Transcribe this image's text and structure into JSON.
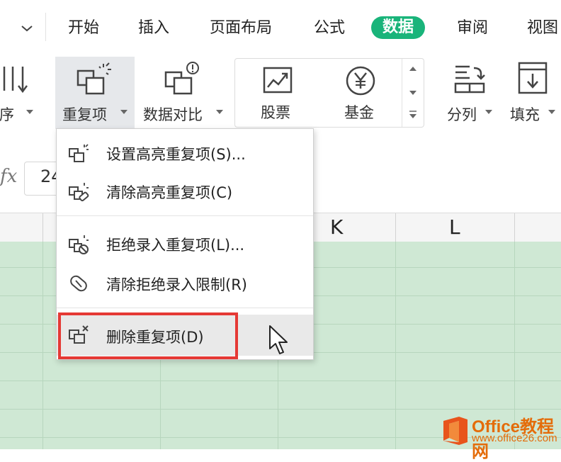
{
  "tabs": [
    {
      "label": "开始"
    },
    {
      "label": "插入"
    },
    {
      "label": "页面布局"
    },
    {
      "label": "公式"
    },
    {
      "label": "数据",
      "active": true
    },
    {
      "label": "审阅"
    },
    {
      "label": "视图"
    }
  ],
  "ribbon": {
    "sort_label": "排序",
    "duplicates_label": "重复项",
    "compare_label": "数据对比",
    "stock_label": "股票",
    "fund_label": "基金",
    "split_label": "分列",
    "fill_label": "填充"
  },
  "formula_bar": {
    "fx": "fx",
    "name_box_value": "24"
  },
  "columns": [
    "K",
    "L"
  ],
  "menu": {
    "items": [
      {
        "label": "设置高亮重复项(S)...",
        "icon": "highlight-duplicates-icon"
      },
      {
        "label": "清除高亮重复项(C)",
        "icon": "clear-highlight-icon"
      },
      {
        "label": "拒绝录入重复项(L)...",
        "icon": "reject-duplicates-icon"
      },
      {
        "label": "清除拒绝录入限制(R)",
        "icon": "clear-restriction-icon"
      },
      {
        "label": "删除重复项(D)",
        "icon": "delete-duplicates-icon",
        "hovered": true
      }
    ]
  },
  "watermark": {
    "name": "Office教程网",
    "url": "www.office26.com"
  },
  "colors": {
    "accent": "#19b47a",
    "grid": "#cfe8d4",
    "highlight": "#e53935",
    "watermark": "#e46c0a"
  }
}
